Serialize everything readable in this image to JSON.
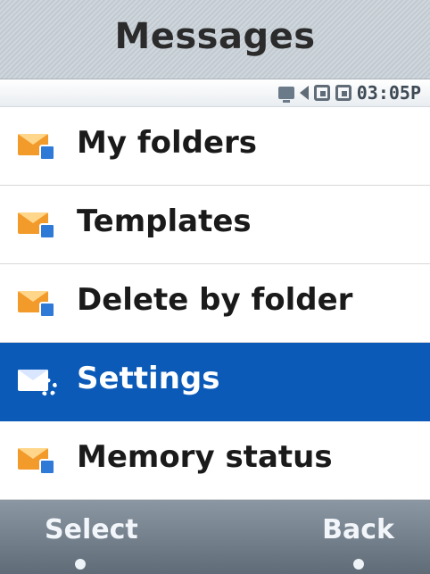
{
  "header": {
    "title": "Messages"
  },
  "status_bar": {
    "icons": [
      "pc-sync-icon",
      "speaker-icon",
      "r-box-icon",
      "grid-box-icon"
    ],
    "time": "03:05P"
  },
  "menu": {
    "items": [
      {
        "label": "My folders",
        "icon": "message-folder-icon"
      },
      {
        "label": "Templates",
        "icon": "message-template-icon"
      },
      {
        "label": "Delete by folder",
        "icon": "message-delete-icon"
      },
      {
        "label": "Settings",
        "icon": "message-settings-icon",
        "selected": true
      },
      {
        "label": "Memory status",
        "icon": "message-memory-icon"
      }
    ]
  },
  "softkeys": {
    "left": "Select",
    "right": "Back"
  },
  "colors": {
    "selection": "#0b5ab8",
    "envelope": "#f29a2a",
    "softbar": "#6d7884"
  }
}
